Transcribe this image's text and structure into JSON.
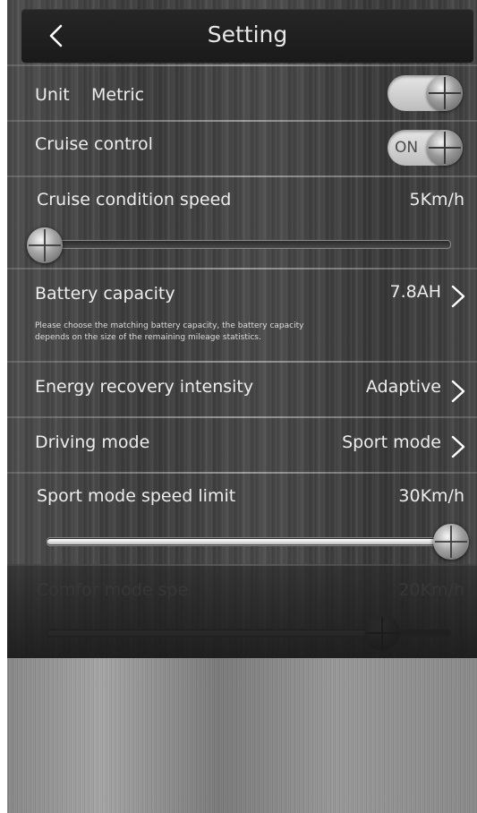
{
  "header": {
    "title": "Setting"
  },
  "settings": {
    "unit": {
      "label": "Unit",
      "value": "Metric",
      "toggle_state": "off"
    },
    "cruise_control": {
      "label": "Cruise control",
      "toggle_text": "ON",
      "toggle_state": "on"
    },
    "cruise_speed": {
      "label": "Cruise condition speed",
      "value": "5Km/h",
      "slider_fraction": 0.0
    },
    "battery": {
      "label": "Battery capacity",
      "value": "7.8AH",
      "note_line1": "Please choose the matching battery capacity, the battery capacity",
      "note_line2": "depends on the size of the remaining mileage statistics."
    },
    "energy_recovery": {
      "label": "Energy recovery intensity",
      "value": "Adaptive"
    },
    "driving_mode": {
      "label": "Driving mode",
      "value": "Sport mode"
    },
    "sport_speed": {
      "label": "Sport mode speed limit",
      "value": "30Km/h",
      "slider_fraction": 1.0
    },
    "comfort_speed": {
      "label": "Comfor mode spe",
      "value": "20Km/h",
      "slider_fraction": 0.85
    }
  },
  "icons": {
    "back": "chevron-left-icon",
    "disclosure": "chevron-right-icon"
  },
  "colors": {
    "text": "#ececec",
    "header_bg": "#1f1f1f",
    "panel_bg": "#404040",
    "slider_fill": "#ffffff"
  }
}
